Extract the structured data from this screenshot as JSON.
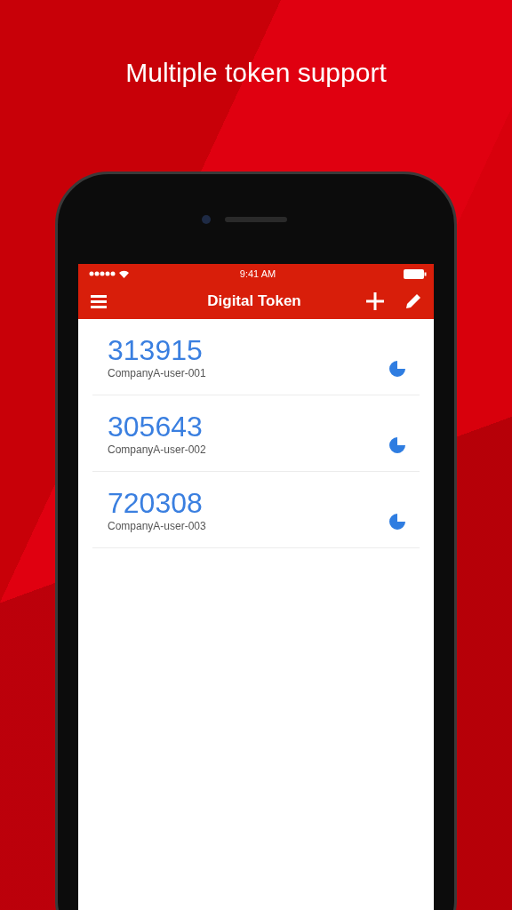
{
  "headline": "Multiple token support",
  "status_bar": {
    "time": "9:41 AM"
  },
  "nav_bar": {
    "title": "Digital Token"
  },
  "tokens": [
    {
      "code": "313915",
      "account": "CompanyA-user-001"
    },
    {
      "code": "305643",
      "account": "CompanyA-user-002"
    },
    {
      "code": "720308",
      "account": "CompanyA-user-003"
    }
  ]
}
